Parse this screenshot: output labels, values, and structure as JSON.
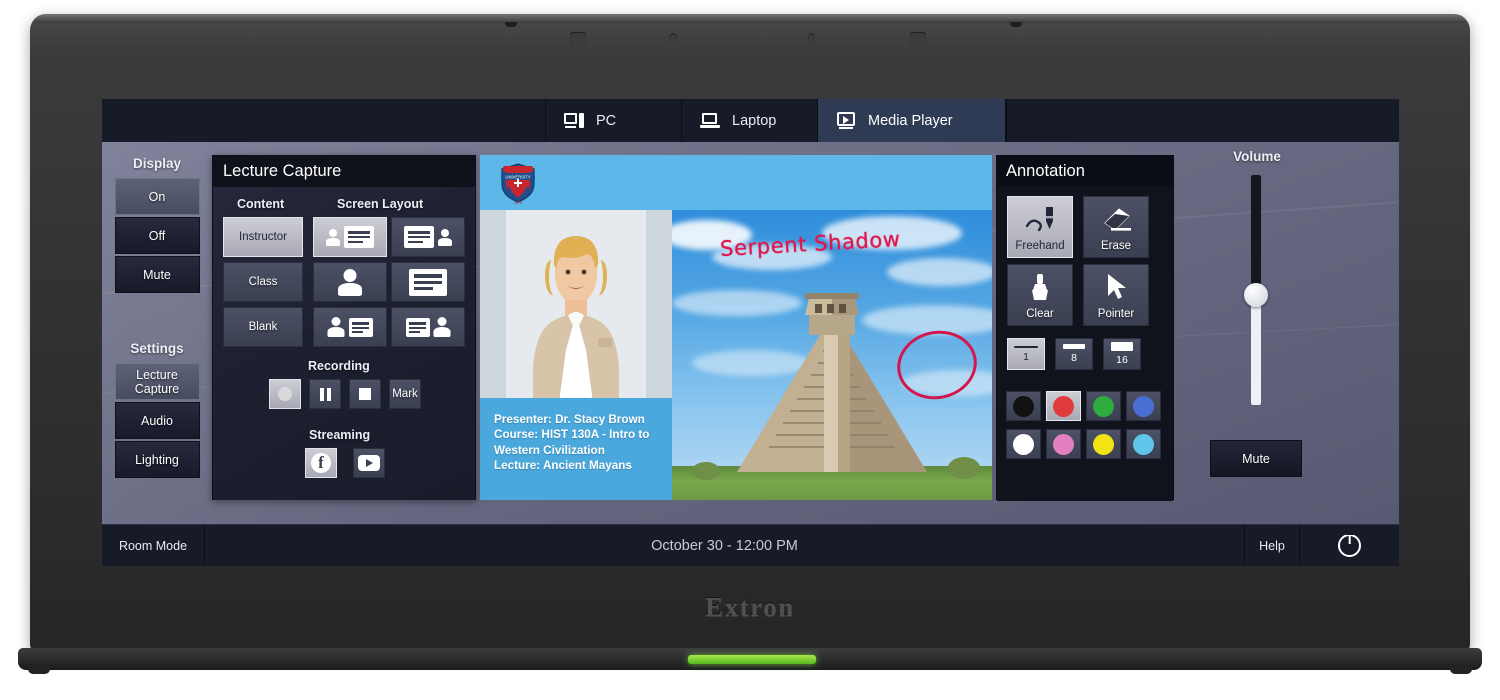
{
  "device": {
    "brand": "Extron",
    "power_led": "#7ed321"
  },
  "tabs": [
    {
      "label": "PC",
      "icon": "desktop-pc-icon",
      "active": false
    },
    {
      "label": "Laptop",
      "icon": "laptop-icon",
      "active": false
    },
    {
      "label": "Media Player",
      "icon": "media-player-icon",
      "active": true
    }
  ],
  "sidebar": {
    "display": {
      "heading": "Display",
      "items": [
        {
          "label": "On",
          "selected": true
        },
        {
          "label": "Off",
          "selected": false
        },
        {
          "label": "Mute",
          "selected": false
        }
      ]
    },
    "settings": {
      "heading": "Settings",
      "items": [
        {
          "label": "Lecture Capture",
          "selected": true
        },
        {
          "label": "Audio",
          "selected": false
        },
        {
          "label": "Lighting",
          "selected": false
        }
      ]
    }
  },
  "lecture_capture": {
    "title": "Lecture Capture",
    "content_label": "Content",
    "content_buttons": [
      {
        "label": "Instructor",
        "selected": true
      },
      {
        "label": "Class",
        "selected": false
      },
      {
        "label": "Blank",
        "selected": false
      }
    ],
    "screen_layout_label": "Screen Layout",
    "layouts": [
      {
        "name": "person-left-content-right",
        "selected": true
      },
      {
        "name": "content-left-person-right",
        "selected": false
      },
      {
        "name": "person-full",
        "selected": false
      },
      {
        "name": "content-full",
        "selected": false
      },
      {
        "name": "person-left-content-right-equal",
        "selected": false
      },
      {
        "name": "content-left-person-right-equal",
        "selected": false
      }
    ],
    "recording_label": "Recording",
    "recording_buttons": [
      {
        "name": "record-button",
        "label": "",
        "icon": "record-circle-icon",
        "selected": true
      },
      {
        "name": "pause-button",
        "label": "",
        "icon": "pause-icon",
        "selected": false
      },
      {
        "name": "stop-button",
        "label": "",
        "icon": "stop-square-icon",
        "selected": false
      },
      {
        "name": "mark-button",
        "label": "Mark",
        "icon": "",
        "selected": false
      }
    ],
    "streaming_label": "Streaming",
    "streaming_buttons": [
      {
        "name": "facebook-stream-button",
        "icon": "facebook-icon",
        "selected": true
      },
      {
        "name": "youtube-stream-button",
        "icon": "youtube-icon",
        "selected": false
      }
    ]
  },
  "preview": {
    "logo": "university-crest-icon",
    "info": {
      "presenter_label": "Presenter:",
      "presenter": "Dr. Stacy Brown",
      "course_label": "Course:",
      "course": "HIST 130A - Intro to",
      "course_line2": "Western Civilization",
      "lecture_label": "Lecture:",
      "lecture": "Ancient Mayans"
    },
    "annotation_text": "Serpent Shadow",
    "annotation_color": "#d4164c"
  },
  "annotation": {
    "title": "Annotation",
    "tools": [
      {
        "label": "Freehand",
        "icon": "pen-freehand-icon",
        "selected": true
      },
      {
        "label": "Erase",
        "icon": "eraser-icon",
        "selected": false
      },
      {
        "label": "Clear",
        "icon": "brush-clear-icon",
        "selected": false
      },
      {
        "label": "Pointer",
        "icon": "cursor-arrow-icon",
        "selected": false
      }
    ],
    "widths": [
      {
        "label": "1",
        "selected": true
      },
      {
        "label": "8",
        "selected": false
      },
      {
        "label": "16",
        "selected": false
      }
    ],
    "colors": [
      {
        "name": "black",
        "hex": "#121212",
        "selected": false
      },
      {
        "name": "red",
        "hex": "#e03a3e",
        "selected": true
      },
      {
        "name": "green",
        "hex": "#2eac3e",
        "selected": false
      },
      {
        "name": "blue",
        "hex": "#4a6fd4",
        "selected": false
      },
      {
        "name": "white",
        "hex": "#ffffff",
        "selected": false
      },
      {
        "name": "pink",
        "hex": "#e47fc0",
        "selected": false
      },
      {
        "name": "yellow",
        "hex": "#f2e312",
        "selected": false
      },
      {
        "name": "cyan",
        "hex": "#5ec6e8",
        "selected": false
      }
    ]
  },
  "volume": {
    "label": "Volume",
    "level_percent": 48,
    "mute_label": "Mute"
  },
  "bottom_bar": {
    "room_mode": "Room Mode",
    "clock": "October 30 - 12:00 PM",
    "help": "Help",
    "power_icon": "power-icon"
  }
}
